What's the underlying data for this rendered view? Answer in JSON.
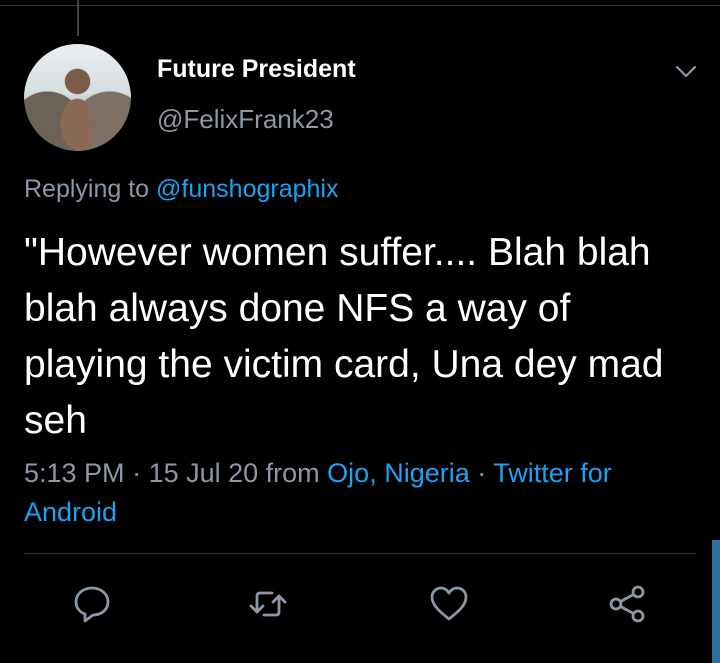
{
  "tweet": {
    "author_name": "Future President",
    "author_handle": "@FelixFrank23",
    "replying_prefix": "Replying to",
    "replying_handle": "@funshographix",
    "text": "\"However women suffer.... Blah blah  blah always done NFS a way of playing the victim card, Una dey mad seh",
    "time": "5:13 PM",
    "sep1": " · ",
    "date": "15 Jul 20",
    "from_word": " from ",
    "location": "Ojo, Nigeria",
    "sep2": " · ",
    "source": "Twitter for Android"
  },
  "icons": {
    "menu": "chevron-down-icon",
    "reply": "reply-icon",
    "retweet": "retweet-icon",
    "like": "heart-icon",
    "share": "share-icon"
  },
  "colors": {
    "background": "#000000",
    "text": "#ffffff",
    "secondary": "#8b98a5",
    "link": "#1da1f2",
    "divider": "#2f3336"
  }
}
